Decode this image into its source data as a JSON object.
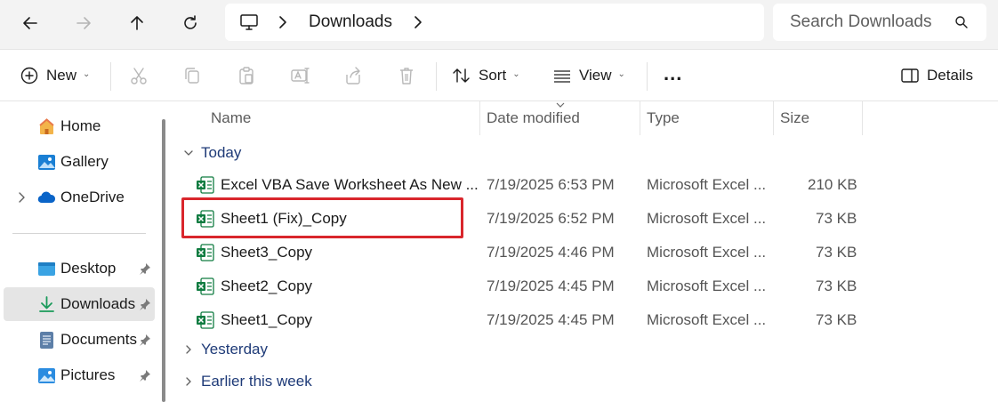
{
  "address_bar": {
    "nav": {
      "back_icon": "arrow-left-icon",
      "forward_icon": "arrow-right-icon",
      "up_icon": "arrow-up-icon",
      "refresh_icon": "refresh-icon"
    },
    "breadcrumb": {
      "root_icon": "monitor-icon",
      "current": "Downloads"
    },
    "search": {
      "placeholder": "Search Downloads",
      "icon": "search-icon"
    }
  },
  "toolbar": {
    "new_label": "New",
    "sort_label": "Sort",
    "view_label": "View",
    "more_label": "...",
    "details_label": "Details",
    "disabled_actions": [
      "cut-icon",
      "copy-icon",
      "paste-icon",
      "rename-icon",
      "share-icon",
      "delete-icon"
    ]
  },
  "sidebar": {
    "items": [
      {
        "label": "Home",
        "icon": "home-icon"
      },
      {
        "label": "Gallery",
        "icon": "gallery-icon"
      },
      {
        "label": "OneDrive",
        "icon": "cloud-icon"
      },
      {
        "label": "Desktop",
        "icon": "desktop-folder-icon"
      },
      {
        "label": "Downloads",
        "icon": "download-icon",
        "selected": true
      },
      {
        "label": "Documents",
        "icon": "documents-icon"
      },
      {
        "label": "Pictures",
        "icon": "pictures-icon"
      }
    ]
  },
  "columns": {
    "name": "Name",
    "date": "Date modified",
    "type": "Type",
    "size": "Size"
  },
  "groups": {
    "today": "Today",
    "yesterday": "Yesterday",
    "earlier": "Earlier this week"
  },
  "files": [
    {
      "name": "Excel VBA Save Worksheet As New ...",
      "date": "7/19/2025 6:53 PM",
      "type": "Microsoft Excel ...",
      "size": "210 KB"
    },
    {
      "name": "Sheet1 (Fix)_Copy",
      "date": "7/19/2025 6:52 PM",
      "type": "Microsoft Excel ...",
      "size": "73 KB"
    },
    {
      "name": "Sheet3_Copy",
      "date": "7/19/2025 4:46 PM",
      "type": "Microsoft Excel ...",
      "size": "73 KB"
    },
    {
      "name": "Sheet2_Copy",
      "date": "7/19/2025 4:45 PM",
      "type": "Microsoft Excel ...",
      "size": "73 KB"
    },
    {
      "name": "Sheet1_Copy",
      "date": "7/19/2025 4:45 PM",
      "type": "Microsoft Excel ...",
      "size": "73 KB"
    }
  ],
  "colors": {
    "accent": "#0067c0",
    "highlight_border": "#d9262c",
    "excel_green": "#107c41",
    "group_text": "#1f3b78"
  }
}
